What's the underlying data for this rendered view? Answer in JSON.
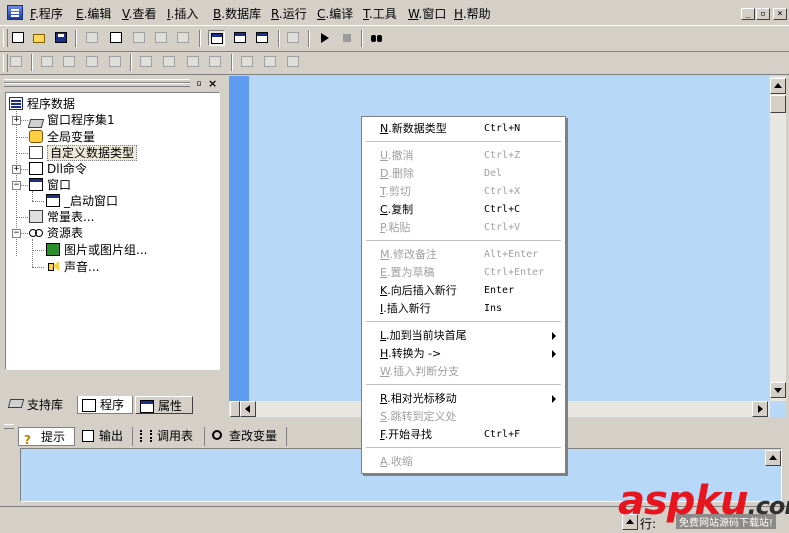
{
  "menubar": {
    "items": [
      {
        "key": "F",
        "label": "程序"
      },
      {
        "key": "E",
        "label": "编辑"
      },
      {
        "key": "V",
        "label": "查看"
      },
      {
        "key": "I",
        "label": "插入"
      },
      {
        "key": "B",
        "label": "数据库"
      },
      {
        "key": "R",
        "label": "运行"
      },
      {
        "key": "C",
        "label": "编译"
      },
      {
        "key": "T",
        "label": "工具"
      },
      {
        "key": "W",
        "label": "窗口"
      },
      {
        "key": "H",
        "label": "帮助"
      }
    ],
    "window_buttons": [
      "_",
      "▫",
      "×"
    ]
  },
  "tree": {
    "root": "程序数据",
    "items": [
      {
        "label": "窗口程序集1"
      },
      {
        "label": "全局变量"
      },
      {
        "label": "自定义数据类型"
      },
      {
        "label": "Dll命令"
      },
      {
        "label": "窗口"
      },
      {
        "label": "_启动窗口"
      },
      {
        "label": "常量表..."
      },
      {
        "label": "资源表"
      },
      {
        "label": "图片或图片组..."
      },
      {
        "label": "声音..."
      }
    ],
    "expanders": [
      "+",
      "+",
      "−",
      "−"
    ],
    "panel_buttons": [
      "▫",
      "×"
    ]
  },
  "panel_tabs": [
    {
      "label": "支持库"
    },
    {
      "label": "程序"
    },
    {
      "label": "属性"
    }
  ],
  "bottom_tabs": [
    {
      "label": "提示"
    },
    {
      "label": "输出"
    },
    {
      "label": "调用表"
    },
    {
      "label": "查改变量"
    }
  ],
  "status": {
    "row_label": "行:"
  },
  "context_menu": {
    "items": [
      {
        "key": "N",
        "label": "新数据类型",
        "shortcut": "Ctrl+N",
        "enabled": true
      },
      {
        "key": "U",
        "label": "撤消",
        "shortcut": "Ctrl+Z",
        "enabled": false
      },
      {
        "key": "D",
        "label": "删除",
        "shortcut": "Del",
        "enabled": false
      },
      {
        "key": "T",
        "label": "剪切",
        "shortcut": "Ctrl+X",
        "enabled": false
      },
      {
        "key": "C",
        "label": "复制",
        "shortcut": "Ctrl+C",
        "enabled": true
      },
      {
        "key": "P",
        "label": "粘贴",
        "shortcut": "Ctrl+V",
        "enabled": false
      },
      {
        "key": "M",
        "label": "修改备注",
        "shortcut": "Alt+Enter",
        "enabled": false
      },
      {
        "key": "E",
        "label": "置为草稿",
        "shortcut": "Ctrl+Enter",
        "enabled": false
      },
      {
        "key": "K",
        "label": "向后插入新行",
        "shortcut": "Enter",
        "enabled": true
      },
      {
        "key": "I",
        "label": "插入新行",
        "shortcut": "Ins",
        "enabled": true
      },
      {
        "key": "L",
        "label": "加到当前块首尾",
        "shortcut": "",
        "enabled": true
      },
      {
        "key": "H",
        "label": "转换为 ->",
        "shortcut": "",
        "enabled": true
      },
      {
        "key": "W",
        "label": "插入判断分支",
        "shortcut": "",
        "enabled": false
      },
      {
        "key": "R",
        "label": "相对光标移动",
        "shortcut": "",
        "enabled": true
      },
      {
        "key": "S",
        "label": "跳转到定义处",
        "shortcut": "",
        "enabled": false
      },
      {
        "key": "F",
        "label": "开始寻找",
        "shortcut": "Ctrl+F",
        "enabled": true
      },
      {
        "key": "A",
        "label": "收缩",
        "shortcut": "",
        "enabled": false
      }
    ]
  },
  "watermark": {
    "text": "aspku",
    "suffix": ".com",
    "subtext": "免费网站源码下载站!"
  },
  "colors": {
    "editor_bg": "#b8d8f8",
    "gutter": "#5f9bf0",
    "chrome": "#d4d0c8",
    "disabled_text": "#a0a0a0",
    "watermark_red": "#e8141e"
  }
}
